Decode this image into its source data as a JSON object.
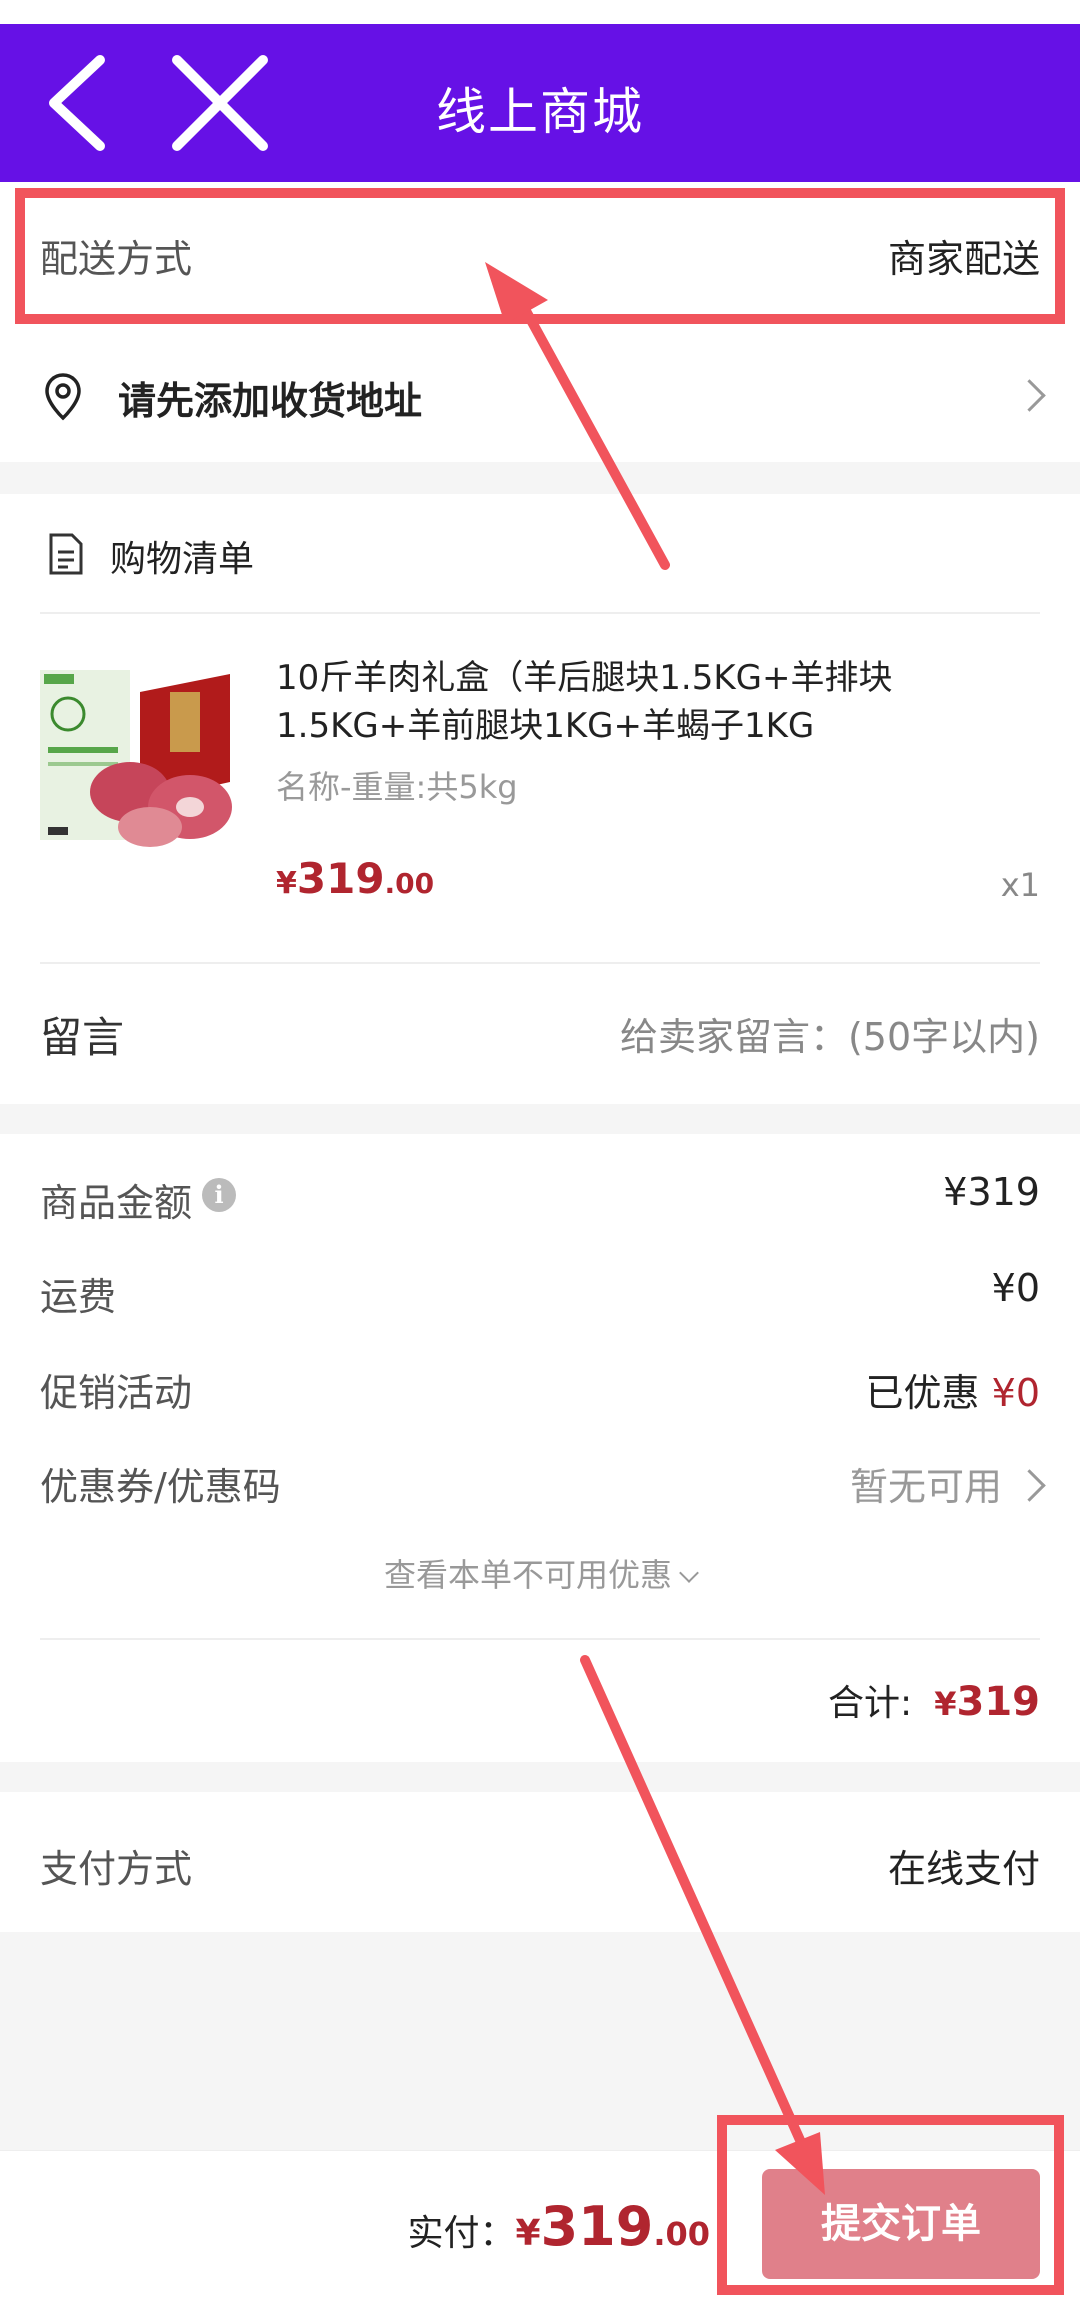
{
  "header": {
    "title": "线上商城",
    "bg_color": "#6611e6",
    "back_icon": "chevron-left-icon",
    "close_icon": "close-icon"
  },
  "delivery": {
    "label": "配送方式",
    "value": "商家配送"
  },
  "address": {
    "icon": "location-pin-icon",
    "text": "请先添加收货地址"
  },
  "cart": {
    "icon": "document-list-icon",
    "title": "购物清单",
    "item": {
      "name": "10斤羊肉礼盒（羊后腿块1.5KG+羊排块1.5KG+羊前腿块1KG+羊蝎子1KG",
      "spec": "名称-重量:共5kg",
      "currency": "¥",
      "price_int": "319",
      "price_dec": ".00",
      "qty": "x1"
    }
  },
  "message": {
    "label": "留言",
    "placeholder": "给卖家留言：(50字以内)"
  },
  "summary": {
    "goods_label": "商品金额",
    "goods_value": "¥319",
    "shipping_label": "运费",
    "shipping_value": "¥0",
    "promo_label": "促销活动",
    "promo_prefix": "已优惠 ",
    "promo_value": "¥0",
    "coupon_label": "优惠券/优惠码",
    "coupon_value": "暂无可用",
    "unavailable_link": "查看本单不可用优惠",
    "total_label": "合计:",
    "total_currency": "¥",
    "total_value": "319"
  },
  "payment": {
    "label": "支付方式",
    "value": "在线支付"
  },
  "footer": {
    "paid_label": "实付：",
    "currency": "¥",
    "price_int": "319",
    "price_dec": ".00",
    "submit_label": "提交订单",
    "submit_color": "#e0808a"
  },
  "accent_color": "#b0252f",
  "annotation_color": "#f1545c"
}
